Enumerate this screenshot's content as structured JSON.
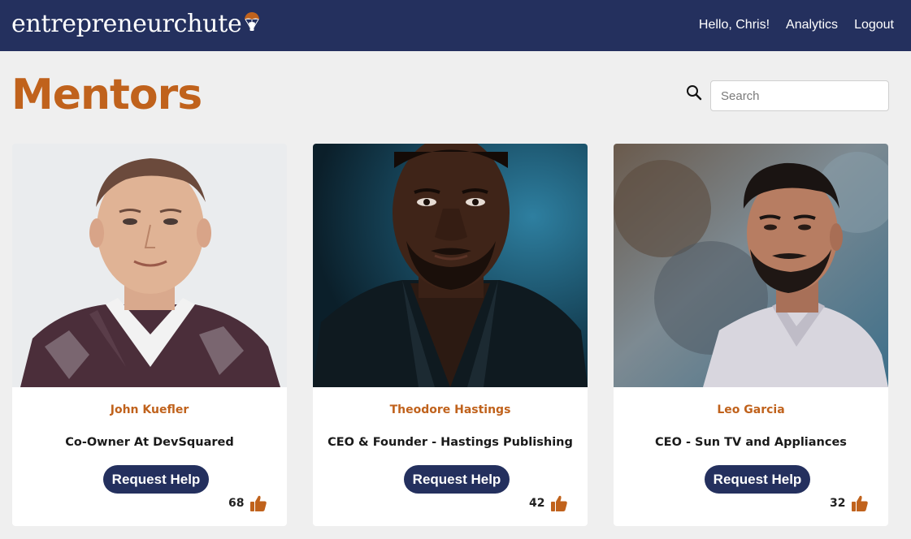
{
  "brand": {
    "name": "entrepreneurchute"
  },
  "nav": {
    "greeting": "Hello, Chris!",
    "links": [
      {
        "label": "Analytics"
      },
      {
        "label": "Logout"
      }
    ]
  },
  "page": {
    "title": "Mentors"
  },
  "search": {
    "placeholder": "Search",
    "value": ""
  },
  "mentors": [
    {
      "name": "John Kuefler",
      "title": "Co-Owner At DevSquared",
      "button_label": "Request Help",
      "likes": "68"
    },
    {
      "name": "Theodore Hastings",
      "title": "CEO & Founder - Hastings Publishing",
      "button_label": "Request Help",
      "likes": "42"
    },
    {
      "name": "Leo Garcia",
      "title": "CEO - Sun TV and Appliances",
      "button_label": "Request Help",
      "likes": "32"
    }
  ],
  "icons": {
    "logo": "parachute-bulb-icon",
    "search": "search-icon",
    "like": "thumbs-up-icon"
  },
  "colors": {
    "navbar": "#24305e",
    "accent": "#c0621c",
    "button": "#24305e",
    "background": "#efefef"
  }
}
